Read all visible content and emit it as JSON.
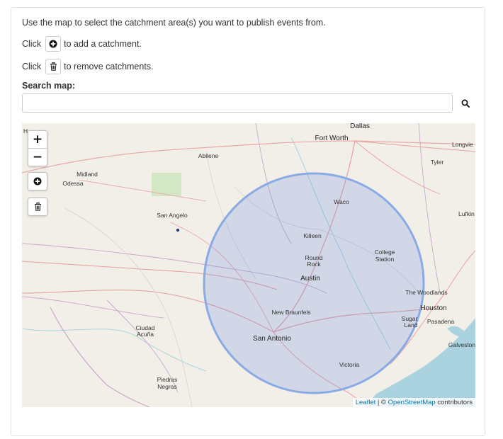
{
  "instructions": {
    "line1": "Use the map to select the catchment area(s) you want to publish events from.",
    "line2_prefix": "Click",
    "line2_suffix": "to add a catchment.",
    "line3_prefix": "Click",
    "line3_suffix": "to remove catchments."
  },
  "search": {
    "label": "Search map:",
    "value": "",
    "placeholder": ""
  },
  "map": {
    "zoom_in": "+",
    "zoom_out": "−",
    "attribution": {
      "leaflet": "Leaflet",
      "separator": "| ©",
      "osm": "OpenStreetMap",
      "suffix": "contributors"
    },
    "cities": {
      "dallas": "Dallas",
      "fort_worth": "Fort Worth",
      "longview": "Longvie",
      "tyler": "Tyler",
      "abilene": "Abilene",
      "midland": "Midland",
      "odessa": "Odessa",
      "san_angelo": "San Angelo",
      "waco": "Waco",
      "lufkin": "Lufkin",
      "killeen": "Killeen",
      "round": "Round",
      "rock": "Rock",
      "college": "College",
      "station": "Station",
      "austin": "Austin",
      "the_woodlands": "The Woodlands",
      "houston": "Houston",
      "new_braunfels": "New Braunfels",
      "sugar": "Sugar",
      "land": "Land",
      "pasadena": "Pasadena",
      "ciudad": "Ciudad",
      "acuna": "Acuña",
      "san_antonio": "San Antonio",
      "galveston": "Galveston",
      "victoria": "Victoria",
      "piedras": "Piedras",
      "negras": "Negras",
      "hobbs": "H"
    },
    "catchment_fill": "#5b82e0",
    "catchment_stroke": "#8aaae6"
  },
  "icons": {
    "add": "plus-circle-icon",
    "remove": "trash-icon",
    "search": "search-icon"
  }
}
